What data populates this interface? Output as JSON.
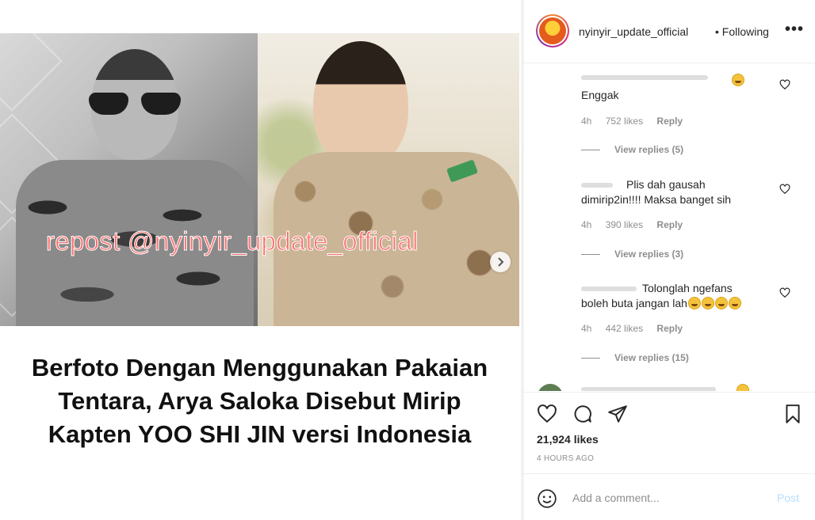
{
  "post": {
    "watermark": "repost @nyinyir_update_official",
    "headline": [
      "Berfoto Dengan Menggunakan Pakaian",
      "Tentara, Arya Saloka Disebut Mirip",
      "Kapten YOO SHI JIN versi Indonesia"
    ],
    "next_icon": "chevron-right-icon"
  },
  "header": {
    "username": "nyinyir_update_official",
    "following": "• Following",
    "more": "•••"
  },
  "comments": [
    {
      "lines": [
        "Enggak"
      ],
      "time": "4h",
      "likes": "752 likes",
      "reply": "Reply",
      "view_replies": "View replies (5)"
    },
    {
      "lines": [
        "Plis dah gausah",
        "dimirip2in!!!! Maksa banget sih"
      ],
      "time": "4h",
      "likes": "390 likes",
      "reply": "Reply",
      "view_replies": "View replies (3)"
    },
    {
      "lines": [
        "Tolonglah ngefans",
        "boleh buta jangan lah"
      ],
      "time": "4h",
      "likes": "442 likes",
      "reply": "Reply",
      "view_replies": "View replies (15)"
    }
  ],
  "stats": {
    "likes": "21,924 likes",
    "timestamp": "4 HOURS AGO"
  },
  "composer": {
    "placeholder": "Add a comment...",
    "post_label": "Post"
  },
  "colors": {
    "link_disabled": "#b2dffc",
    "muted": "#8e8e8e",
    "watermark": "#ff6a6a"
  }
}
